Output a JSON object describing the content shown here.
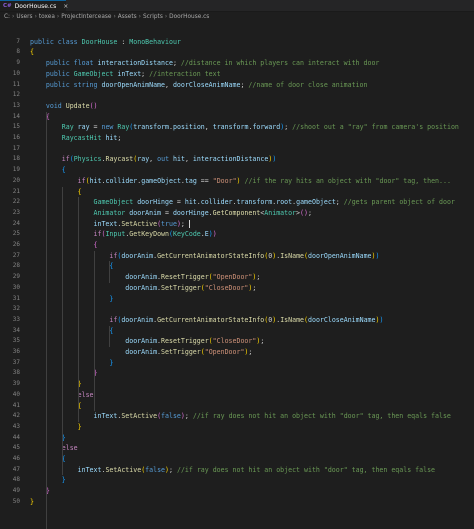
{
  "tab": {
    "label": "DoorHouse.cs",
    "icon": "csharp-file-icon"
  },
  "breadcrumb": [
    "C:",
    "Users",
    "toxea",
    "ProjectIntercease",
    "Assets",
    "Scripts",
    "DoorHouse.cs"
  ],
  "lines": [
    {
      "n": "",
      "tokens": []
    },
    {
      "n": "7",
      "tokens": [
        [
          "kw",
          "public "
        ],
        [
          "kw",
          "class "
        ],
        [
          "type",
          "DoorHouse"
        ],
        [
          "op",
          " : "
        ],
        [
          "type",
          "MonoBehaviour"
        ]
      ]
    },
    {
      "n": "8",
      "tokens": [
        [
          "br1",
          "{"
        ]
      ]
    },
    {
      "n": "9",
      "tokens": [
        [
          "kw",
          "    public "
        ],
        [
          "kw",
          "float "
        ],
        [
          "var",
          "interactionDistance"
        ],
        [
          "op",
          "; "
        ],
        [
          "cmt",
          "//distance in which players can interact with door"
        ]
      ]
    },
    {
      "n": "10",
      "tokens": [
        [
          "kw",
          "    public "
        ],
        [
          "type",
          "GameObject "
        ],
        [
          "var",
          "inText"
        ],
        [
          "op",
          "; "
        ],
        [
          "cmt",
          "//interaction text"
        ]
      ]
    },
    {
      "n": "11",
      "tokens": [
        [
          "kw",
          "    public "
        ],
        [
          "kw",
          "string "
        ],
        [
          "var",
          "doorOpenAnimName"
        ],
        [
          "op",
          ", "
        ],
        [
          "var",
          "doorCloseAnimName"
        ],
        [
          "op",
          "; "
        ],
        [
          "cmt",
          "//name of door close animation"
        ]
      ]
    },
    {
      "n": "12",
      "tokens": []
    },
    {
      "n": "13",
      "tokens": [
        [
          "kw",
          "    void "
        ],
        [
          "fn",
          "Update"
        ],
        [
          "br2",
          "()"
        ]
      ]
    },
    {
      "n": "14",
      "tokens": [
        [
          "br2",
          "    {"
        ]
      ]
    },
    {
      "n": "15",
      "tokens": [
        [
          "type",
          "        Ray "
        ],
        [
          "var",
          "ray"
        ],
        [
          "op",
          " = "
        ],
        [
          "kw",
          "new "
        ],
        [
          "type",
          "Ray"
        ],
        [
          "br3",
          "("
        ],
        [
          "var",
          "transform"
        ],
        [
          "op",
          "."
        ],
        [
          "var",
          "position"
        ],
        [
          "op",
          ", "
        ],
        [
          "var",
          "transform"
        ],
        [
          "op",
          "."
        ],
        [
          "var",
          "forward"
        ],
        [
          "br3",
          ")"
        ],
        [
          "op",
          "; "
        ],
        [
          "cmt",
          "//shoot out a \"ray\" from camera's position"
        ]
      ]
    },
    {
      "n": "16",
      "tokens": [
        [
          "type",
          "        RaycastHit "
        ],
        [
          "var",
          "hit"
        ],
        [
          "op",
          ";"
        ]
      ]
    },
    {
      "n": "17",
      "tokens": []
    },
    {
      "n": "18",
      "tokens": [
        [
          "ctl",
          "        if"
        ],
        [
          "br3",
          "("
        ],
        [
          "type",
          "Physics"
        ],
        [
          "op",
          "."
        ],
        [
          "fn",
          "Raycast"
        ],
        [
          "br1",
          "("
        ],
        [
          "var",
          "ray"
        ],
        [
          "op",
          ", "
        ],
        [
          "kw",
          "out "
        ],
        [
          "var",
          "hit"
        ],
        [
          "op",
          ", "
        ],
        [
          "var",
          "interactionDistance"
        ],
        [
          "br1",
          ")"
        ],
        [
          "br3",
          ")"
        ]
      ]
    },
    {
      "n": "19",
      "tokens": [
        [
          "br3",
          "        {"
        ]
      ]
    },
    {
      "n": "20",
      "tokens": [
        [
          "ctl",
          "            if"
        ],
        [
          "br1",
          "("
        ],
        [
          "var",
          "hit"
        ],
        [
          "op",
          "."
        ],
        [
          "var",
          "collider"
        ],
        [
          "op",
          "."
        ],
        [
          "var",
          "gameObject"
        ],
        [
          "op",
          "."
        ],
        [
          "var",
          "tag"
        ],
        [
          "op",
          " == "
        ],
        [
          "str",
          "\"Door\""
        ],
        [
          "br1",
          ")"
        ],
        [
          "cmt",
          " //if the ray hits an object with \"door\" tag, then..."
        ]
      ]
    },
    {
      "n": "21",
      "tokens": [
        [
          "br1",
          "            {"
        ]
      ]
    },
    {
      "n": "22",
      "tokens": [
        [
          "type",
          "                GameObject "
        ],
        [
          "var",
          "doorHinge"
        ],
        [
          "op",
          " = "
        ],
        [
          "var",
          "hit"
        ],
        [
          "op",
          "."
        ],
        [
          "var",
          "collider"
        ],
        [
          "op",
          "."
        ],
        [
          "var",
          "transform"
        ],
        [
          "op",
          "."
        ],
        [
          "var",
          "root"
        ],
        [
          "op",
          "."
        ],
        [
          "var",
          "gameObject"
        ],
        [
          "op",
          "; "
        ],
        [
          "cmt",
          "//gets parent object of door"
        ]
      ]
    },
    {
      "n": "23",
      "tokens": [
        [
          "type",
          "                Animator "
        ],
        [
          "var",
          "doorAnim"
        ],
        [
          "op",
          " = "
        ],
        [
          "var",
          "doorHinge"
        ],
        [
          "op",
          "."
        ],
        [
          "fn",
          "GetComponent"
        ],
        [
          "op",
          "<"
        ],
        [
          "type",
          "Animator"
        ],
        [
          "op",
          ">"
        ],
        [
          "br2",
          "()"
        ],
        [
          "op",
          ";"
        ]
      ]
    },
    {
      "n": "24",
      "tokens": [
        [
          "var",
          "                inText"
        ],
        [
          "op",
          "."
        ],
        [
          "fn",
          "SetActive"
        ],
        [
          "br2",
          "("
        ],
        [
          "kw",
          "true"
        ],
        [
          "br2",
          ")"
        ],
        [
          "op",
          "; "
        ]
      ]
    },
    {
      "n": "25",
      "tokens": [
        [
          "ctl",
          "                if"
        ],
        [
          "br2",
          "("
        ],
        [
          "type",
          "Input"
        ],
        [
          "op",
          "."
        ],
        [
          "fn",
          "GetKeyDown"
        ],
        [
          "br3",
          "("
        ],
        [
          "type",
          "KeyCode"
        ],
        [
          "op",
          "."
        ],
        [
          "var",
          "E"
        ],
        [
          "br3",
          ")"
        ],
        [
          "br2",
          ")"
        ]
      ]
    },
    {
      "n": "26",
      "tokens": [
        [
          "br2",
          "                {"
        ]
      ]
    },
    {
      "n": "27",
      "tokens": [
        [
          "ctl",
          "                    if"
        ],
        [
          "br3",
          "("
        ],
        [
          "var",
          "doorAnim"
        ],
        [
          "op",
          "."
        ],
        [
          "fn",
          "GetCurrentAnimatorStateInfo"
        ],
        [
          "br1",
          "("
        ],
        [
          "op",
          "0"
        ],
        [
          "br1",
          ")"
        ],
        [
          "op",
          "."
        ],
        [
          "fn",
          "IsName"
        ],
        [
          "br1",
          "("
        ],
        [
          "var",
          "doorOpenAnimName"
        ],
        [
          "br1",
          ")"
        ],
        [
          "br3",
          ")"
        ]
      ]
    },
    {
      "n": "28",
      "tokens": [
        [
          "br3",
          "                    {"
        ]
      ]
    },
    {
      "n": "29",
      "tokens": [
        [
          "var",
          "                        doorAnim"
        ],
        [
          "op",
          "."
        ],
        [
          "fn",
          "ResetTrigger"
        ],
        [
          "br1",
          "("
        ],
        [
          "str",
          "\"OpenDoor\""
        ],
        [
          "br1",
          ")"
        ],
        [
          "op",
          ";"
        ]
      ]
    },
    {
      "n": "30",
      "tokens": [
        [
          "var",
          "                        doorAnim"
        ],
        [
          "op",
          "."
        ],
        [
          "fn",
          "SetTrigger"
        ],
        [
          "br1",
          "("
        ],
        [
          "str",
          "\"CloseDoor\""
        ],
        [
          "br1",
          ")"
        ],
        [
          "op",
          ";"
        ]
      ]
    },
    {
      "n": "31",
      "tokens": [
        [
          "br3",
          "                    }"
        ]
      ]
    },
    {
      "n": "32",
      "tokens": []
    },
    {
      "n": "33",
      "tokens": [
        [
          "ctl",
          "                    if"
        ],
        [
          "br3",
          "("
        ],
        [
          "var",
          "doorAnim"
        ],
        [
          "op",
          "."
        ],
        [
          "fn",
          "GetCurrentAnimatorStateInfo"
        ],
        [
          "br1",
          "("
        ],
        [
          "op",
          "0"
        ],
        [
          "br1",
          ")"
        ],
        [
          "op",
          "."
        ],
        [
          "fn",
          "IsName"
        ],
        [
          "br1",
          "("
        ],
        [
          "var",
          "doorCloseAnimName"
        ],
        [
          "br1",
          ")"
        ],
        [
          "br3",
          ")"
        ]
      ]
    },
    {
      "n": "34",
      "tokens": [
        [
          "br3",
          "                    {"
        ]
      ]
    },
    {
      "n": "35",
      "tokens": [
        [
          "var",
          "                        doorAnim"
        ],
        [
          "op",
          "."
        ],
        [
          "fn",
          "ResetTrigger"
        ],
        [
          "br1",
          "("
        ],
        [
          "str",
          "\"CloseDoor\""
        ],
        [
          "br1",
          ")"
        ],
        [
          "op",
          ";"
        ]
      ]
    },
    {
      "n": "36",
      "tokens": [
        [
          "var",
          "                        doorAnim"
        ],
        [
          "op",
          "."
        ],
        [
          "fn",
          "SetTrigger"
        ],
        [
          "br1",
          "("
        ],
        [
          "str",
          "\"OpenDoor\""
        ],
        [
          "br1",
          ")"
        ],
        [
          "op",
          ";"
        ]
      ]
    },
    {
      "n": "37",
      "tokens": [
        [
          "br3",
          "                    }"
        ]
      ]
    },
    {
      "n": "38",
      "tokens": [
        [
          "br2",
          "                }"
        ]
      ]
    },
    {
      "n": "39",
      "tokens": [
        [
          "br1",
          "            }"
        ]
      ]
    },
    {
      "n": "40",
      "tokens": [
        [
          "ctl",
          "            else"
        ]
      ]
    },
    {
      "n": "41",
      "tokens": [
        [
          "br1",
          "            {"
        ]
      ]
    },
    {
      "n": "42",
      "tokens": [
        [
          "var",
          "                inText"
        ],
        [
          "op",
          "."
        ],
        [
          "fn",
          "SetActive"
        ],
        [
          "br2",
          "("
        ],
        [
          "kw",
          "false"
        ],
        [
          "br2",
          ")"
        ],
        [
          "op",
          "; "
        ],
        [
          "cmt",
          "//if ray does not hit an object with \"door\" tag, then eqals false"
        ]
      ]
    },
    {
      "n": "43",
      "tokens": [
        [
          "br1",
          "            }"
        ]
      ]
    },
    {
      "n": "44",
      "tokens": [
        [
          "br3",
          "        }"
        ]
      ]
    },
    {
      "n": "45",
      "tokens": [
        [
          "ctl",
          "        else"
        ]
      ]
    },
    {
      "n": "46",
      "tokens": [
        [
          "br3",
          "        {"
        ]
      ]
    },
    {
      "n": "47",
      "tokens": [
        [
          "var",
          "            inText"
        ],
        [
          "op",
          "."
        ],
        [
          "fn",
          "SetActive"
        ],
        [
          "br1",
          "("
        ],
        [
          "kw",
          "false"
        ],
        [
          "br1",
          ")"
        ],
        [
          "op",
          "; "
        ],
        [
          "cmt",
          "//if ray does not hit an object with \"door\" tag, then eqals false"
        ]
      ]
    },
    {
      "n": "48",
      "tokens": [
        [
          "br3",
          "        }"
        ]
      ]
    },
    {
      "n": "49",
      "tokens": [
        [
          "br2",
          "    }"
        ]
      ]
    },
    {
      "n": "50",
      "tokens": [
        [
          "br1",
          "}"
        ]
      ]
    }
  ]
}
